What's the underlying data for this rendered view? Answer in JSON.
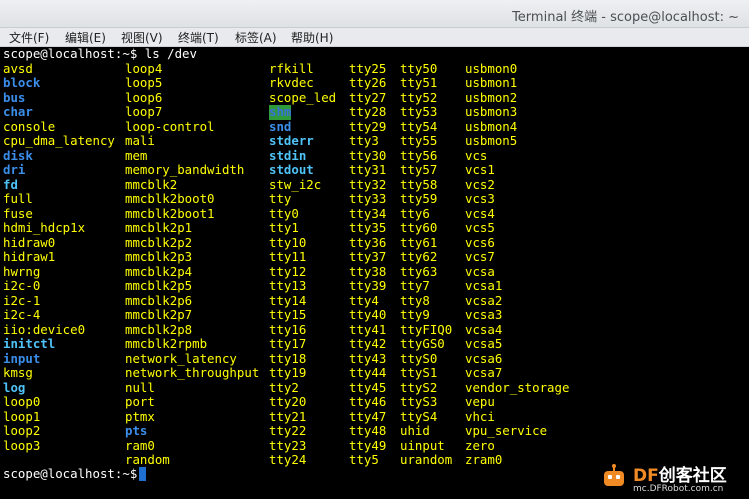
{
  "window": {
    "title": "Terminal 终端 - scope@localhost: ~"
  },
  "menu": [
    "文件(F)",
    "编辑(E)",
    "视图(V)",
    "终端(T)",
    "标签(A)",
    "帮助(H)"
  ],
  "terminal": {
    "command_line": "scope@localhost:~$ ls /dev",
    "prompt_end": "scope@localhost:~$ ",
    "columns": [
      [
        [
          "avsd",
          "f"
        ],
        [
          "block",
          "d"
        ],
        [
          "bus",
          "d"
        ],
        [
          "char",
          "d"
        ],
        [
          "console",
          "f"
        ],
        [
          "cpu_dma_latency",
          "f"
        ],
        [
          "disk",
          "d"
        ],
        [
          "dri",
          "d"
        ],
        [
          "fd",
          "l"
        ],
        [
          "full",
          "f"
        ],
        [
          "fuse",
          "f"
        ],
        [
          "hdmi_hdcp1x",
          "f"
        ],
        [
          "hidraw0",
          "f"
        ],
        [
          "hidraw1",
          "f"
        ],
        [
          "hwrng",
          "f"
        ],
        [
          "i2c-0",
          "f"
        ],
        [
          "i2c-1",
          "f"
        ],
        [
          "i2c-4",
          "f"
        ],
        [
          "iio:device0",
          "f"
        ],
        [
          "initctl",
          "l"
        ],
        [
          "input",
          "d"
        ],
        [
          "kmsg",
          "f"
        ],
        [
          "log",
          "l"
        ],
        [
          "loop0",
          "f"
        ],
        [
          "loop1",
          "f"
        ],
        [
          "loop2",
          "f"
        ],
        [
          "loop3",
          "f"
        ]
      ],
      [
        [
          "loop4",
          "f"
        ],
        [
          "loop5",
          "f"
        ],
        [
          "loop6",
          "f"
        ],
        [
          "loop7",
          "f"
        ],
        [
          "loop-control",
          "f"
        ],
        [
          "mali",
          "f"
        ],
        [
          "mem",
          "f"
        ],
        [
          "memory_bandwidth",
          "f"
        ],
        [
          "mmcblk2",
          "f"
        ],
        [
          "mmcblk2boot0",
          "f"
        ],
        [
          "mmcblk2boot1",
          "f"
        ],
        [
          "mmcblk2p1",
          "f"
        ],
        [
          "mmcblk2p2",
          "f"
        ],
        [
          "mmcblk2p3",
          "f"
        ],
        [
          "mmcblk2p4",
          "f"
        ],
        [
          "mmcblk2p5",
          "f"
        ],
        [
          "mmcblk2p6",
          "f"
        ],
        [
          "mmcblk2p7",
          "f"
        ],
        [
          "mmcblk2p8",
          "f"
        ],
        [
          "mmcblk2rpmb",
          "f"
        ],
        [
          "network_latency",
          "f"
        ],
        [
          "network_throughput",
          "f"
        ],
        [
          "null",
          "f"
        ],
        [
          "port",
          "f"
        ],
        [
          "ptmx",
          "f"
        ],
        [
          "pts",
          "d"
        ],
        [
          "ram0",
          "f"
        ],
        [
          "random",
          "f"
        ]
      ],
      [
        [
          "rfkill",
          "f"
        ],
        [
          "rkvdec",
          "f"
        ],
        [
          "scope_led",
          "f"
        ],
        [
          "shm",
          "sh"
        ],
        [
          "snd",
          "d"
        ],
        [
          "stderr",
          "l"
        ],
        [
          "stdin",
          "l"
        ],
        [
          "stdout",
          "l"
        ],
        [
          "stw_i2c",
          "f"
        ],
        [
          "tty",
          "f"
        ],
        [
          "tty0",
          "f"
        ],
        [
          "tty1",
          "f"
        ],
        [
          "tty10",
          "f"
        ],
        [
          "tty11",
          "f"
        ],
        [
          "tty12",
          "f"
        ],
        [
          "tty13",
          "f"
        ],
        [
          "tty14",
          "f"
        ],
        [
          "tty15",
          "f"
        ],
        [
          "tty16",
          "f"
        ],
        [
          "tty17",
          "f"
        ],
        [
          "tty18",
          "f"
        ],
        [
          "tty19",
          "f"
        ],
        [
          "tty2",
          "f"
        ],
        [
          "tty20",
          "f"
        ],
        [
          "tty21",
          "f"
        ],
        [
          "tty22",
          "f"
        ],
        [
          "tty23",
          "f"
        ],
        [
          "tty24",
          "f"
        ]
      ],
      [
        [
          "tty25",
          "f"
        ],
        [
          "tty26",
          "f"
        ],
        [
          "tty27",
          "f"
        ],
        [
          "tty28",
          "f"
        ],
        [
          "tty29",
          "f"
        ],
        [
          "tty3",
          "f"
        ],
        [
          "tty30",
          "f"
        ],
        [
          "tty31",
          "f"
        ],
        [
          "tty32",
          "f"
        ],
        [
          "tty33",
          "f"
        ],
        [
          "tty34",
          "f"
        ],
        [
          "tty35",
          "f"
        ],
        [
          "tty36",
          "f"
        ],
        [
          "tty37",
          "f"
        ],
        [
          "tty38",
          "f"
        ],
        [
          "tty39",
          "f"
        ],
        [
          "tty4",
          "f"
        ],
        [
          "tty40",
          "f"
        ],
        [
          "tty41",
          "f"
        ],
        [
          "tty42",
          "f"
        ],
        [
          "tty43",
          "f"
        ],
        [
          "tty44",
          "f"
        ],
        [
          "tty45",
          "f"
        ],
        [
          "tty46",
          "f"
        ],
        [
          "tty47",
          "f"
        ],
        [
          "tty48",
          "f"
        ],
        [
          "tty49",
          "f"
        ],
        [
          "tty5",
          "f"
        ]
      ],
      [
        [
          "tty50",
          "f"
        ],
        [
          "tty51",
          "f"
        ],
        [
          "tty52",
          "f"
        ],
        [
          "tty53",
          "f"
        ],
        [
          "tty54",
          "f"
        ],
        [
          "tty55",
          "f"
        ],
        [
          "tty56",
          "f"
        ],
        [
          "tty57",
          "f"
        ],
        [
          "tty58",
          "f"
        ],
        [
          "tty59",
          "f"
        ],
        [
          "tty6",
          "f"
        ],
        [
          "tty60",
          "f"
        ],
        [
          "tty61",
          "f"
        ],
        [
          "tty62",
          "f"
        ],
        [
          "tty63",
          "f"
        ],
        [
          "tty7",
          "f"
        ],
        [
          "tty8",
          "f"
        ],
        [
          "tty9",
          "f"
        ],
        [
          "ttyFIQ0",
          "f"
        ],
        [
          "ttyGS0",
          "f"
        ],
        [
          "ttyS0",
          "f"
        ],
        [
          "ttyS1",
          "f"
        ],
        [
          "ttyS2",
          "f"
        ],
        [
          "ttyS3",
          "f"
        ],
        [
          "ttyS4",
          "f"
        ],
        [
          "uhid",
          "f"
        ],
        [
          "uinput",
          "f"
        ],
        [
          "urandom",
          "f"
        ]
      ],
      [
        [
          "usbmon0",
          "f"
        ],
        [
          "usbmon1",
          "f"
        ],
        [
          "usbmon2",
          "f"
        ],
        [
          "usbmon3",
          "f"
        ],
        [
          "usbmon4",
          "f"
        ],
        [
          "usbmon5",
          "f"
        ],
        [
          "vcs",
          "f"
        ],
        [
          "vcs1",
          "f"
        ],
        [
          "vcs2",
          "f"
        ],
        [
          "vcs3",
          "f"
        ],
        [
          "vcs4",
          "f"
        ],
        [
          "vcs5",
          "f"
        ],
        [
          "vcs6",
          "f"
        ],
        [
          "vcs7",
          "f"
        ],
        [
          "vcsa",
          "f"
        ],
        [
          "vcsa1",
          "f"
        ],
        [
          "vcsa2",
          "f"
        ],
        [
          "vcsa3",
          "f"
        ],
        [
          "vcsa4",
          "f"
        ],
        [
          "vcsa5",
          "f"
        ],
        [
          "vcsa6",
          "f"
        ],
        [
          "vcsa7",
          "f"
        ],
        [
          "vendor_storage",
          "f"
        ],
        [
          "vepu",
          "f"
        ],
        [
          "vhci",
          "f"
        ],
        [
          "vpu_service",
          "f"
        ],
        [
          "zero",
          "f"
        ],
        [
          "zram0",
          "f"
        ]
      ]
    ]
  },
  "watermark": {
    "brand_accent": "DF",
    "brand_rest": "创客社区",
    "url": "mc.DFRobot.com.cn"
  },
  "colors": {
    "file": "#ffff00",
    "directory": "#3b8eea",
    "link": "#4fc3f7",
    "shm_bg": "#2e9b3a",
    "cursor": "#1f6fd1",
    "logo_accent": "#f08a24"
  }
}
